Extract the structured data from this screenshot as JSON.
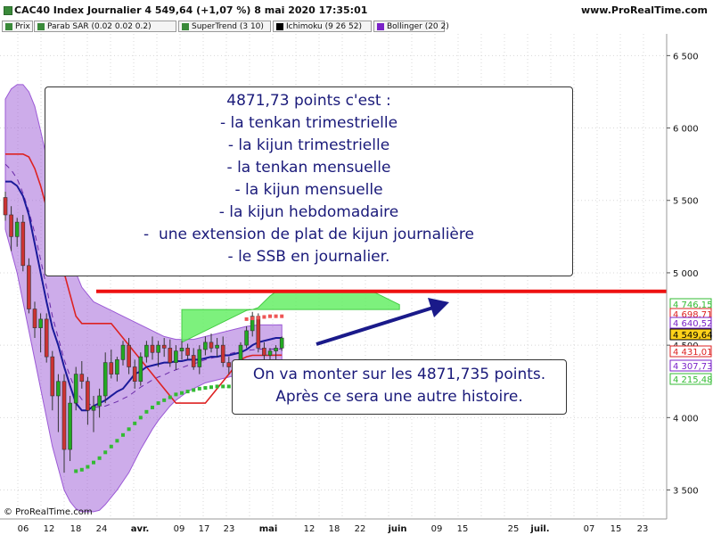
{
  "header": {
    "title": "CAC40 Index Journalier 4 549,64 (+1,07 %) 8 mai 2020 17:35:01",
    "site": "www.ProRealTime.com"
  },
  "legend": [
    {
      "label": "Prix",
      "color": "#3a8a3a"
    },
    {
      "label": "Parab SAR (0.02 0.02 0.2)",
      "color": "#3a8a3a"
    },
    {
      "label": "SuperTrend (3 10)",
      "color": "#3a8a3a"
    },
    {
      "label": "Ichimoku (9 26 52)",
      "color": "#000000"
    },
    {
      "label": "Bollinger (20 2)",
      "color": "#7a22c8"
    }
  ],
  "notes": {
    "main": [
      "4871,73 points c'est :",
      "- la tenkan trimestrielle",
      "- la kijun trimestrielle",
      "- la tenkan mensuelle",
      "- la kijun mensuelle",
      "- la kijun hebdomadaire",
      "-  une extension de plat de kijun journalière",
      "- le SSB en journalier."
    ],
    "second": [
      "On va monter sur les 4871,735 points.",
      "Après ce sera une autre histoire."
    ]
  },
  "credit": "© ProRealTime.com",
  "colors": {
    "cloud": "#66ee66",
    "bollinger": "#9b59d6",
    "kijun": "#dd2222",
    "tenkan": "#1a1a9a",
    "sar": "#33bb33",
    "horizontal_line": "#ee1111",
    "arrow": "#1a1a8a",
    "last_price_bg": "#ffd21a"
  },
  "chart_data": {
    "type": "candlestick",
    "y_axis": {
      "min": 3300,
      "max": 6650,
      "ticks": [
        3500,
        4000,
        4500,
        5000,
        5500,
        6000,
        6500
      ],
      "tick_labels": [
        "3 500",
        "4 000",
        "4 500",
        "5 000",
        "5 500",
        "6 000",
        "6 500"
      ]
    },
    "x_axis": {
      "tick_labels": [
        "06",
        "12",
        "18",
        "24",
        "avr.",
        "09",
        "17",
        "23",
        "mai",
        "12",
        "18",
        "22",
        "juin",
        "09",
        "15",
        "25",
        "juil.",
        "07",
        "15",
        "23"
      ]
    },
    "price_tags": [
      {
        "value": 4746.15,
        "label": "4 746,15",
        "color": "#33bb33"
      },
      {
        "value": 4698.71,
        "label": "4 698,71",
        "color": "#dd2222"
      },
      {
        "value": 4640.52,
        "label": "4 640,52",
        "color": "#7a22c8"
      },
      {
        "value": 4549.64,
        "label": "4 549,64",
        "color": "#000000",
        "highlight": true
      },
      {
        "value": 4431.01,
        "label": "4 431,01",
        "color": "#dd2222"
      },
      {
        "value": 4307.73,
        "label": "4 307,73",
        "color": "#7a22c8"
      },
      {
        "value": 4215.48,
        "label": "4 215,48",
        "color": "#33bb33"
      }
    ],
    "horizontal_line": {
      "value": 4871.73
    },
    "candles": [
      [
        5520,
        5560,
        5360,
        5400
      ],
      [
        5400,
        5460,
        5150,
        5250
      ],
      [
        5250,
        5380,
        5180,
        5350
      ],
      [
        5350,
        5400,
        5010,
        5050
      ],
      [
        5050,
        5100,
        4720,
        4750
      ],
      [
        4750,
        4800,
        4550,
        4620
      ],
      [
        4620,
        4720,
        4450,
        4680
      ],
      [
        4680,
        4720,
        4380,
        4420
      ],
      [
        4420,
        4460,
        4050,
        4150
      ],
      [
        4150,
        4300,
        3900,
        4250
      ],
      [
        4250,
        4300,
        3620,
        3780
      ],
      [
        3780,
        4150,
        3700,
        4100
      ],
      [
        4100,
        4350,
        4050,
        4300
      ],
      [
        4300,
        4390,
        4200,
        4250
      ],
      [
        4250,
        4280,
        3950,
        4050
      ],
      [
        4050,
        4150,
        3900,
        4080
      ],
      [
        4080,
        4200,
        4000,
        4150
      ],
      [
        4150,
        4450,
        4100,
        4380
      ],
      [
        4380,
        4470,
        4270,
        4300
      ],
      [
        4300,
        4420,
        4250,
        4400
      ],
      [
        4400,
        4530,
        4360,
        4500
      ],
      [
        4500,
        4550,
        4300,
        4350
      ],
      [
        4350,
        4400,
        4200,
        4250
      ],
      [
        4250,
        4450,
        4220,
        4420
      ],
      [
        4420,
        4530,
        4380,
        4500
      ],
      [
        4500,
        4560,
        4400,
        4450
      ],
      [
        4450,
        4530,
        4350,
        4500
      ],
      [
        4500,
        4550,
        4420,
        4480
      ],
      [
        4480,
        4540,
        4350,
        4380
      ],
      [
        4380,
        4500,
        4330,
        4460
      ],
      [
        4460,
        4530,
        4400,
        4480
      ],
      [
        4480,
        4510,
        4400,
        4430
      ],
      [
        4430,
        4480,
        4330,
        4350
      ],
      [
        4350,
        4500,
        4300,
        4470
      ],
      [
        4470,
        4560,
        4430,
        4520
      ],
      [
        4520,
        4580,
        4450,
        4480
      ],
      [
        4480,
        4550,
        4420,
        4500
      ],
      [
        4500,
        4560,
        4350,
        4380
      ],
      [
        4380,
        4420,
        4300,
        4350
      ],
      [
        4350,
        4400,
        4300,
        4380
      ],
      [
        4380,
        4520,
        4360,
        4500
      ],
      [
        4500,
        4630,
        4480,
        4600
      ],
      [
        4600,
        4730,
        4560,
        4700
      ],
      [
        4700,
        4720,
        4450,
        4480
      ],
      [
        4480,
        4520,
        4400,
        4430
      ],
      [
        4430,
        4480,
        4380,
        4460
      ],
      [
        4460,
        4500,
        4400,
        4480
      ],
      [
        4480,
        4560,
        4460,
        4549.64
      ]
    ],
    "tenkan": [
      5630,
      5630,
      5600,
      5530,
      5400,
      5200,
      5000,
      4800,
      4620,
      4500,
      4350,
      4220,
      4100,
      4050,
      4050,
      4080,
      4100,
      4120,
      4150,
      4180,
      4200,
      4250,
      4300,
      4320,
      4350,
      4360,
      4370,
      4380,
      4380,
      4390,
      4390,
      4400,
      4400,
      4400,
      4410,
      4420,
      4420,
      4430,
      4430,
      4440,
      4450,
      4470,
      4500,
      4520,
      4530,
      4540,
      4550,
      4550
    ],
    "kijun": [
      5820,
      5820,
      5820,
      5820,
      5800,
      5720,
      5600,
      5450,
      5300,
      5150,
      5000,
      4850,
      4700,
      4650,
      4650,
      4650,
      4650,
      4650,
      4650,
      4600,
      4550,
      4500,
      4450,
      4400,
      4350,
      4300,
      4250,
      4200,
      4150,
      4100,
      4100,
      4100,
      4100,
      4100,
      4100,
      4150,
      4200,
      4250,
      4300,
      4350,
      4400,
      4420,
      4430,
      4430,
      4430,
      4430,
      4431,
      4431
    ],
    "bb_upper": [
      6200,
      6270,
      6300,
      6300,
      6250,
      6150,
      5980,
      5800,
      5600,
      5450,
      5300,
      5150,
      5000,
      4900,
      4850,
      4800,
      4780,
      4760,
      4740,
      4720,
      4700,
      4680,
      4660,
      4640,
      4620,
      4600,
      4580,
      4560,
      4550,
      4540,
      4540,
      4540,
      4540,
      4550,
      4560,
      4570,
      4580,
      4590,
      4600,
      4610,
      4620,
      4630,
      4635,
      4640,
      4640,
      4640,
      4640,
      4640.52
    ],
    "bb_lower": [
      5300,
      5150,
      5000,
      4800,
      4600,
      4400,
      4200,
      4000,
      3800,
      3650,
      3500,
      3420,
      3370,
      3350,
      3350,
      3350,
      3360,
      3400,
      3450,
      3500,
      3560,
      3620,
      3700,
      3780,
      3850,
      3920,
      3980,
      4030,
      4080,
      4120,
      4150,
      4180,
      4200,
      4220,
      4240,
      4250,
      4260,
      4270,
      4280,
      4290,
      4295,
      4300,
      4300,
      4305,
      4306,
      4307,
      4307,
      4307.73
    ],
    "sar": [
      null,
      null,
      null,
      null,
      null,
      null,
      null,
      null,
      null,
      null,
      null,
      null,
      3630,
      3640,
      3660,
      3690,
      3720,
      3760,
      3800,
      3840,
      3880,
      3920,
      3960,
      4000,
      4040,
      4070,
      4100,
      4120,
      4140,
      4160,
      4170,
      4180,
      4190,
      4200,
      4205,
      4210,
      4215,
      4215,
      4215,
      4215,
      4215,
      4215,
      4215,
      4215,
      4215,
      4215,
      4215,
      4215.48
    ],
    "sar_above": [
      4680,
      4685,
      4690,
      4695,
      4700,
      4700,
      4700
    ],
    "cloud_x_range": [
      30,
      48
    ],
    "cloud_top": [
      4746,
      4746,
      4746,
      4746,
      4746,
      4746,
      4746,
      4746,
      4746,
      4746,
      4746,
      4746,
      4746,
      4760,
      4800,
      4840,
      4870,
      4870,
      4870,
      4871.73,
      4871.73,
      4871.73,
      4871.73,
      4871.73,
      4871.73,
      4871.73,
      4871.73,
      4871.73,
      4871.73,
      4871.73,
      4871.73,
      4871.73,
      4871.73,
      4860,
      4840,
      4820,
      4800,
      4780
    ],
    "cloud_bottom": [
      4520,
      4540,
      4560,
      4580,
      4600,
      4620,
      4640,
      4660,
      4680,
      4700,
      4720,
      4740,
      4746,
      4746,
      4746,
      4746,
      4746,
      4746,
      4746,
      4746,
      4746,
      4746,
      4746,
      4746,
      4746,
      4746,
      4746,
      4746,
      4746,
      4746,
      4746,
      4746,
      4746,
      4746,
      4746,
      4746,
      4746,
      4746
    ]
  }
}
